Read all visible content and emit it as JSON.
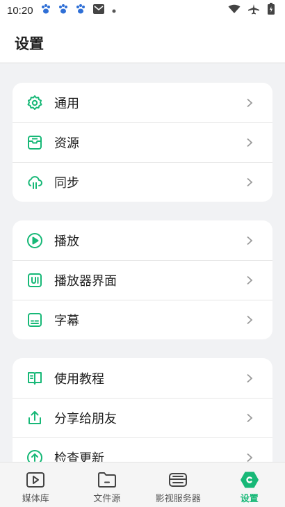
{
  "status_bar": {
    "time": "10:20",
    "left_icons": [
      "paw-icon",
      "paw-icon",
      "paw-icon",
      "mail-icon",
      "dot-icon"
    ],
    "right_icons": [
      "wifi-icon",
      "airplane-mode-icon",
      "battery-icon"
    ]
  },
  "header": {
    "title": "设置"
  },
  "colors": {
    "accent": "#17b877",
    "background": "#f1f2f4",
    "card": "#ffffff"
  },
  "groups": [
    {
      "items": [
        {
          "label": "通用",
          "icon": "gear-icon"
        },
        {
          "label": "资源",
          "icon": "inbox-icon"
        },
        {
          "label": "同步",
          "icon": "cloud-sync-icon"
        }
      ]
    },
    {
      "items": [
        {
          "label": "播放",
          "icon": "play-circle-icon"
        },
        {
          "label": "播放器界面",
          "icon": "ui-box-icon"
        },
        {
          "label": "字幕",
          "icon": "subtitle-icon"
        }
      ]
    },
    {
      "items": [
        {
          "label": "使用教程",
          "icon": "book-icon"
        },
        {
          "label": "分享给朋友",
          "icon": "share-icon"
        },
        {
          "label": "检查更新",
          "icon": "update-arrow-icon"
        }
      ]
    }
  ],
  "bottom_nav": {
    "items": [
      {
        "label": "媒体库",
        "icon": "media-library-icon",
        "active": false
      },
      {
        "label": "文件源",
        "icon": "folder-icon",
        "active": false
      },
      {
        "label": "影视服务器",
        "icon": "server-icon",
        "active": false
      },
      {
        "label": "设置",
        "icon": "settings-hex-icon",
        "active": true
      }
    ]
  }
}
